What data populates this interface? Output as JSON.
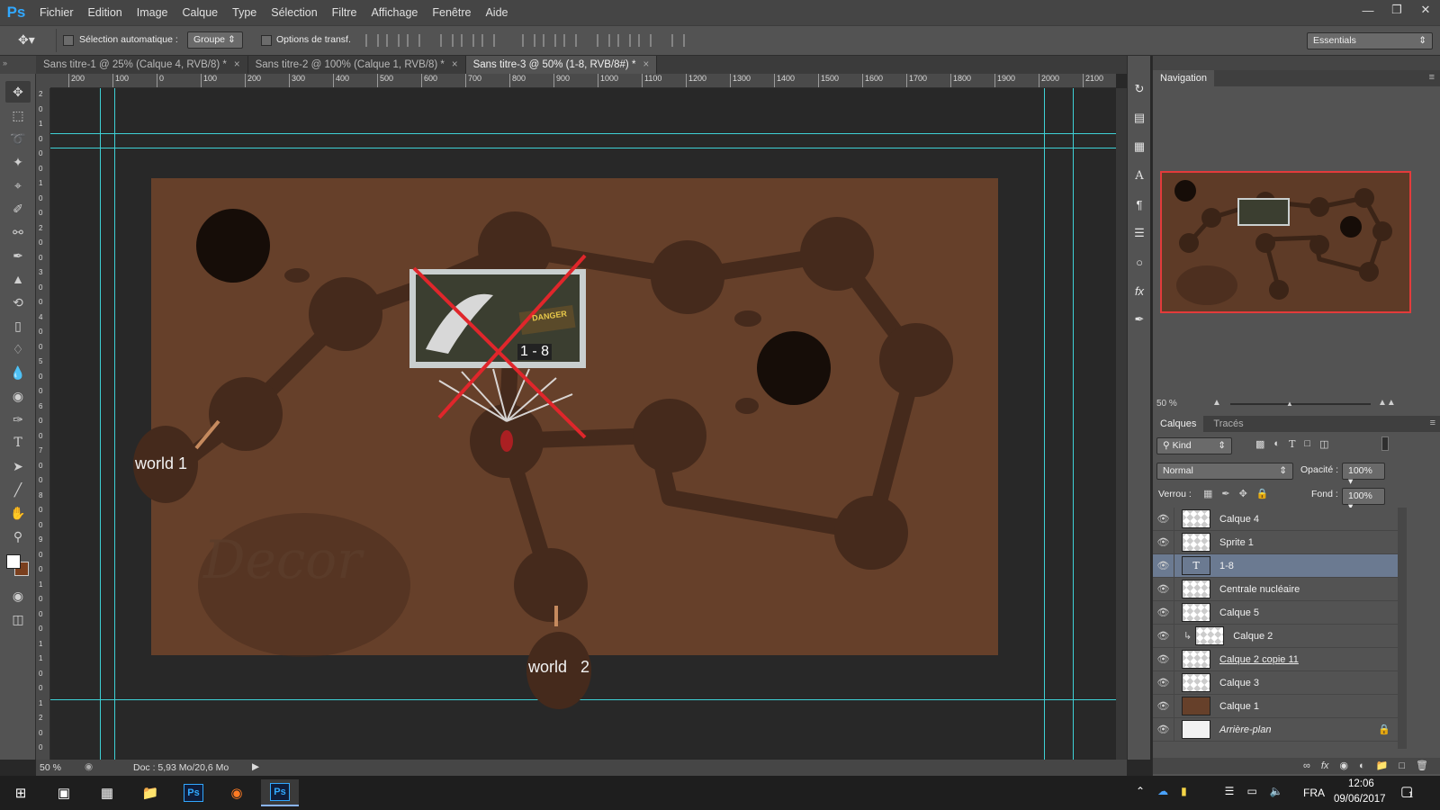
{
  "app": {
    "logo": "Ps",
    "accent": "#31a8ff"
  },
  "menu": [
    "Fichier",
    "Edition",
    "Image",
    "Calque",
    "Type",
    "Sélection",
    "Filtre",
    "Affichage",
    "Fenêtre",
    "Aide"
  ],
  "options": {
    "auto_select_label": "Sélection automatique :",
    "auto_select_value": "Groupe",
    "transform_label": "Options de transf.",
    "workspace": "Essentials"
  },
  "tabs": [
    {
      "label": "Sans titre-1 @ 25% (Calque 4, RVB/8) *"
    },
    {
      "label": "Sans titre-2 @ 100% (Calque 1, RVB/8) *"
    },
    {
      "label": "Sans titre-3 @ 50% (1-8, RVB/8#) *"
    }
  ],
  "ruler_h": [
    "200",
    "100",
    "0",
    "100",
    "200",
    "300",
    "400",
    "500",
    "600",
    "700",
    "800",
    "900",
    "1000",
    "1100",
    "1200",
    "1300",
    "1400",
    "1500",
    "1600",
    "1700",
    "1800",
    "1900",
    "2000",
    "2100"
  ],
  "ruler_v": [
    "2",
    "0",
    "1",
    "0",
    "0",
    "0",
    "1",
    "0",
    "0",
    "2",
    "0",
    "0",
    "3",
    "0",
    "0",
    "4",
    "0",
    "0",
    "5",
    "0",
    "0",
    "6",
    "0",
    "0",
    "7",
    "0",
    "0",
    "8",
    "0",
    "0",
    "9",
    "0",
    "0",
    "1",
    "0",
    "0",
    "0",
    "1",
    "1",
    "0",
    "0",
    "1",
    "2",
    "0",
    "0"
  ],
  "canvas": {
    "bg_color": "#66402a",
    "world1": "world 1",
    "world2_a": "world",
    "world2_b": "2",
    "level": "1 - 8",
    "danger": "DANGER",
    "decor": "Decor"
  },
  "status": {
    "zoom": "50 %",
    "doc": "Doc : 5,93 Mo/20,6 Mo"
  },
  "navigator": {
    "title": "Navigation",
    "zoom": "50 %"
  },
  "layers_panel": {
    "tab_layers": "Calques",
    "tab_paths": "Tracés",
    "filter": "Kind",
    "blend": "Normal",
    "opacity_label": "Opacité :",
    "opacity": "100%",
    "lock_label": "Verrou :",
    "fill_label": "Fond :",
    "fill": "100%",
    "layers": [
      {
        "name": "Calque 4",
        "active": false
      },
      {
        "name": "Sprite 1",
        "active": false
      },
      {
        "name": "1-8",
        "active": true
      },
      {
        "name": "Centrale nucléaire",
        "active": false
      },
      {
        "name": "Calque 5",
        "active": false
      },
      {
        "name": "Calque 2",
        "active": false
      },
      {
        "name": "Calque 2 copie 11",
        "active": false
      },
      {
        "name": "Calque 3",
        "active": false
      },
      {
        "name": "Calque 1",
        "active": false
      },
      {
        "name": "Arrière-plan",
        "active": false
      }
    ]
  },
  "taskbar": {
    "lang": "FRA",
    "time": "12:06",
    "date": "09/06/2017",
    "notif": "1"
  }
}
